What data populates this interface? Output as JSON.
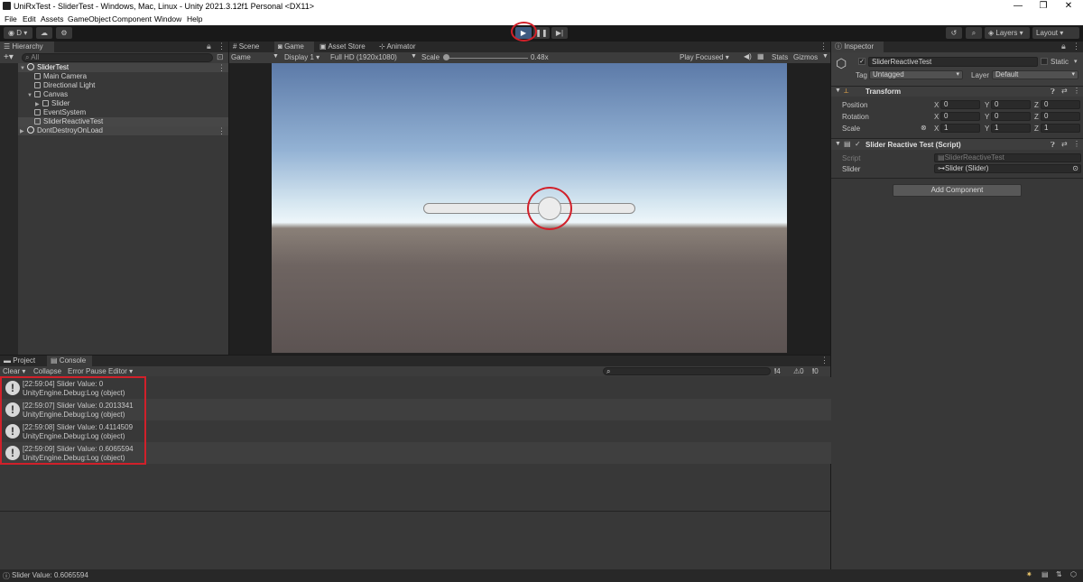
{
  "window": {
    "title": "UniRxTest - SliderTest - Windows, Mac, Linux - Unity 2021.3.12f1 Personal <DX11>",
    "controls": [
      "—",
      "❐",
      "✕"
    ]
  },
  "menu": [
    "File",
    "Edit",
    "Assets",
    "GameObject",
    "Component",
    "Window",
    "Help"
  ],
  "toolbar": {
    "account": "D",
    "layers": "Layers",
    "layout": "Layout"
  },
  "hierarchy": {
    "tab": "Hierarchy",
    "search_placeholder": "All",
    "items": [
      {
        "label": "SliderTest"
      },
      {
        "label": "Main Camera"
      },
      {
        "label": "Directional Light"
      },
      {
        "label": "Canvas"
      },
      {
        "label": "Slider"
      },
      {
        "label": "EventSystem"
      },
      {
        "label": "SliderReactiveTest"
      },
      {
        "label": "DontDestroyOnLoad"
      }
    ]
  },
  "scene_tabs": [
    "Scene",
    "Game",
    "Asset Store",
    "Animator"
  ],
  "game_bar": {
    "mode": "Game",
    "display": "Display 1",
    "resolution": "Full HD (1920x1080)",
    "scale_label": "Scale",
    "scale_value": "0.48x",
    "play_focused": "Play Focused",
    "stats": "Stats",
    "gizmos": "Gizmos"
  },
  "game_view": {
    "slider_value": 0.6065594
  },
  "inspector": {
    "tab": "Inspector",
    "object_name": "SliderReactiveTest",
    "static_label": "Static",
    "tag_label": "Tag",
    "tag_value": "Untagged",
    "layer_label": "Layer",
    "layer_value": "Default",
    "transform": {
      "title": "Transform",
      "rows": [
        {
          "label": "Position",
          "x": "0",
          "y": "0",
          "z": "0"
        },
        {
          "label": "Rotation",
          "x": "0",
          "y": "0",
          "z": "0"
        },
        {
          "label": "Scale",
          "x": "1",
          "y": "1",
          "z": "1"
        }
      ]
    },
    "script_component": {
      "title": "Slider Reactive Test (Script)",
      "script_label": "Script",
      "script_value": "SliderReactiveTest",
      "slider_label": "Slider",
      "slider_value": "Slider (Slider)"
    },
    "add_component": "Add Component"
  },
  "bottom_tabs": [
    "Project",
    "Console"
  ],
  "console": {
    "toolbar": {
      "clear": "Clear",
      "collapse": "Collapse",
      "error_pause": "Error Pause",
      "editor": "Editor"
    },
    "counts": {
      "log": "4",
      "warn": "0",
      "error": "0"
    },
    "logs": [
      {
        "line1": "[22:59:04] Slider Value: 0",
        "line2": "UnityEngine.Debug:Log (object)"
      },
      {
        "line1": "[22:59:07] Slider Value: 0.2013341",
        "line2": "UnityEngine.Debug:Log (object)"
      },
      {
        "line1": "[22:59:08] Slider Value: 0.4114509",
        "line2": "UnityEngine.Debug:Log (object)"
      },
      {
        "line1": "[22:59:09] Slider Value: 0.6065594",
        "line2": "UnityEngine.Debug:Log (object)"
      }
    ]
  },
  "status_bar": {
    "message": "Slider Value: 0.6065594"
  }
}
